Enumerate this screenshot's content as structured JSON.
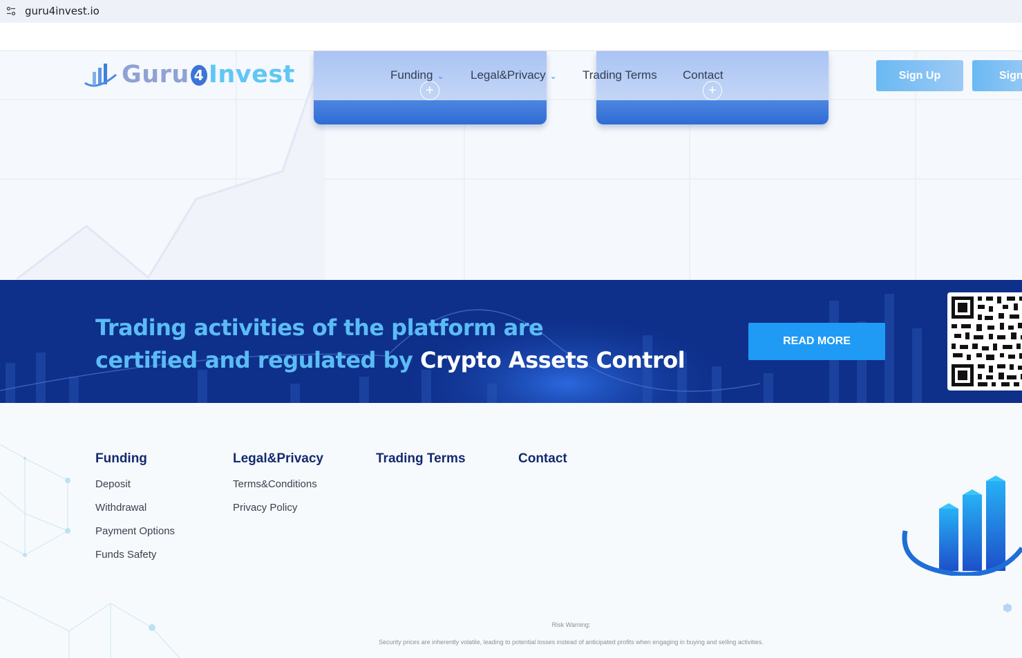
{
  "browser": {
    "url": "guru4invest.io"
  },
  "header": {
    "logo": {
      "part1": "Guru",
      "part2": "4",
      "part3": "Invest"
    },
    "nav": [
      {
        "label": "Funding",
        "has_dropdown": true
      },
      {
        "label": "Legal&Privacy",
        "has_dropdown": true
      },
      {
        "label": "Trading Terms",
        "has_dropdown": false
      },
      {
        "label": "Contact",
        "has_dropdown": false
      }
    ],
    "sign_up": "Sign Up",
    "sign_in": "Sign In"
  },
  "banner": {
    "line1": "Trading activities of the platform are",
    "line2_a": "certified and regulated by ",
    "line2_b": "Crypto Assets Control",
    "read_more": "READ MORE"
  },
  "footer": {
    "columns": [
      {
        "title": "Funding",
        "links": [
          "Deposit",
          "Withdrawal",
          "Payment Options",
          "Funds Safety"
        ]
      },
      {
        "title": "Legal&Privacy",
        "links": [
          "Terms&Conditions",
          "Privacy Policy"
        ]
      },
      {
        "title": "Trading Terms",
        "links": []
      },
      {
        "title": "Contact",
        "links": []
      }
    ],
    "risk_title": "Risk Warning:",
    "risk_text": "Security prices are inherently volatile, leading to potential losses instead of anticipated profits when engaging in buying and selling activities."
  },
  "colors": {
    "brand_blue": "#1f9bf5",
    "navy": "#0e2f8a",
    "heading": "#142a6e"
  },
  "icons": [
    "site-info-icon",
    "chevron-down-icon",
    "plus-circle-icon",
    "qr-code-icon",
    "bar-chart-logo-icon"
  ]
}
